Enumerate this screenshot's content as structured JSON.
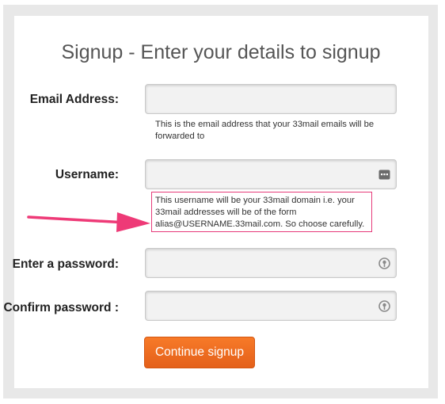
{
  "page": {
    "title": "Signup - Enter your details to signup"
  },
  "form": {
    "email_label": "Email Address:",
    "email_value": "",
    "email_help": "This is the email address that your 33mail emails will be forwarded to",
    "username_label": "Username:",
    "username_value": "",
    "username_help_line1": "This username will be your 33mail domain i.e. your",
    "username_help_line2": "33mail addresses will be of the form",
    "username_help_line3": "alias@USERNAME.33mail.com. So choose carefully.",
    "password_label": "Enter a password:",
    "password_value": "",
    "confirm_label": "Confirm password :",
    "confirm_value": "",
    "submit_label": "Continue signup"
  },
  "colors": {
    "button": "#f06d22",
    "highlight_box": "#e63b7a",
    "arrow": "#ee3a77"
  },
  "icons": {
    "username_field": "contact-card-icon",
    "password_field": "key-icon",
    "confirm_field": "key-icon",
    "annotation": "arrow-right-icon"
  }
}
